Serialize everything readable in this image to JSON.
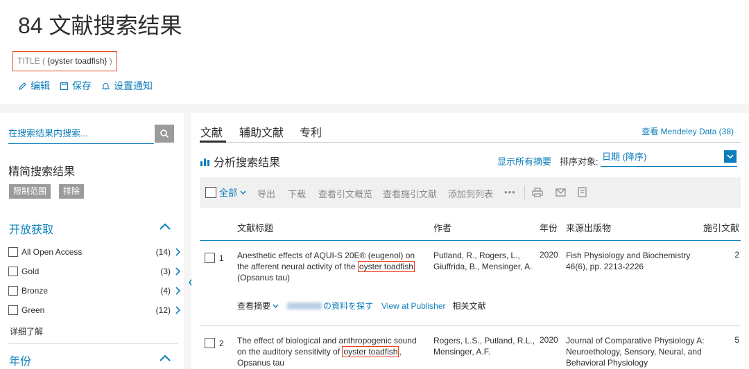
{
  "header": {
    "title": "84 文献搜索结果",
    "query_prefix": "TITLE ( ",
    "query_term": "{oyster toadfish}",
    "query_suffix": " )",
    "actions": [
      {
        "label": "编辑",
        "icon": "pencil-icon"
      },
      {
        "label": "保存",
        "icon": "save-icon"
      },
      {
        "label": "设置通知",
        "icon": "bell-icon"
      }
    ]
  },
  "sidebar": {
    "search_placeholder": "在搜索结果内搜索...",
    "refine_title": "精简搜索结果",
    "limit_label": "限制范围",
    "exclude_label": "排除",
    "open_access": {
      "title": "开放获取",
      "items": [
        {
          "label": "All Open Access",
          "count": "(14)"
        },
        {
          "label": "Gold",
          "count": "(3)"
        },
        {
          "label": "Bronze",
          "count": "(4)"
        },
        {
          "label": "Green",
          "count": "(12)"
        }
      ],
      "more": "详细了解"
    },
    "year_title": "年份"
  },
  "main": {
    "tabs": [
      "文献",
      "辅助文献",
      "专利"
    ],
    "mendeley": "查看 Mendeley Data (38)",
    "analyze": "分析搜索结果",
    "show_abstracts": "显示所有摘要",
    "sort_label": "排序对象:",
    "sort_value": "日期 (降序)",
    "toolbar": {
      "all": "全部",
      "export": "导出",
      "download": "下载",
      "citation_overview": "查看引文概览",
      "cited_by": "查看施引文献",
      "add_to_list": "添加到列表",
      "more": "•••"
    },
    "columns": {
      "title": "文献标题",
      "authors": "作者",
      "year": "年份",
      "source": "来源出版物",
      "cited": "施引文献"
    },
    "rows": [
      {
        "num": "1",
        "title_pre": "Anesthetic effects of AQUI-S 20E® (eugenol) on the afferent neural activity of the ",
        "title_hl": "oyster toadfish",
        "title_post": " (Opsanus tau)",
        "authors": "Putland, R., Rogers, L., Giuffrida, B., Mensinger, A.",
        "year": "2020",
        "source": "Fish Physiology and Biochemistry 46(6), pp. 2213-2226",
        "cited": "2",
        "view_abstract": "查看摘要",
        "library_suffix": "の資料を探す",
        "publisher": "View at Publisher",
        "related": "相关文献"
      },
      {
        "num": "2",
        "title_pre": "The effect of biological and anthropogenic sound on the auditory sensitivity of ",
        "title_hl": "oyster toadfish",
        "title_post": ", Opsanus tau",
        "authors": "Rogers, L.S., Putland, R.L., Mensinger, A.F.",
        "year": "2020",
        "source": "Journal of Comparative Physiology A: Neuroethology, Sensory, Neural, and Behavioral Physiology",
        "cited": "5"
      }
    ]
  },
  "colors": {
    "accent": "#0c7dbb",
    "highlight": "#e9411e",
    "gray_button": "#9b9b9b"
  }
}
